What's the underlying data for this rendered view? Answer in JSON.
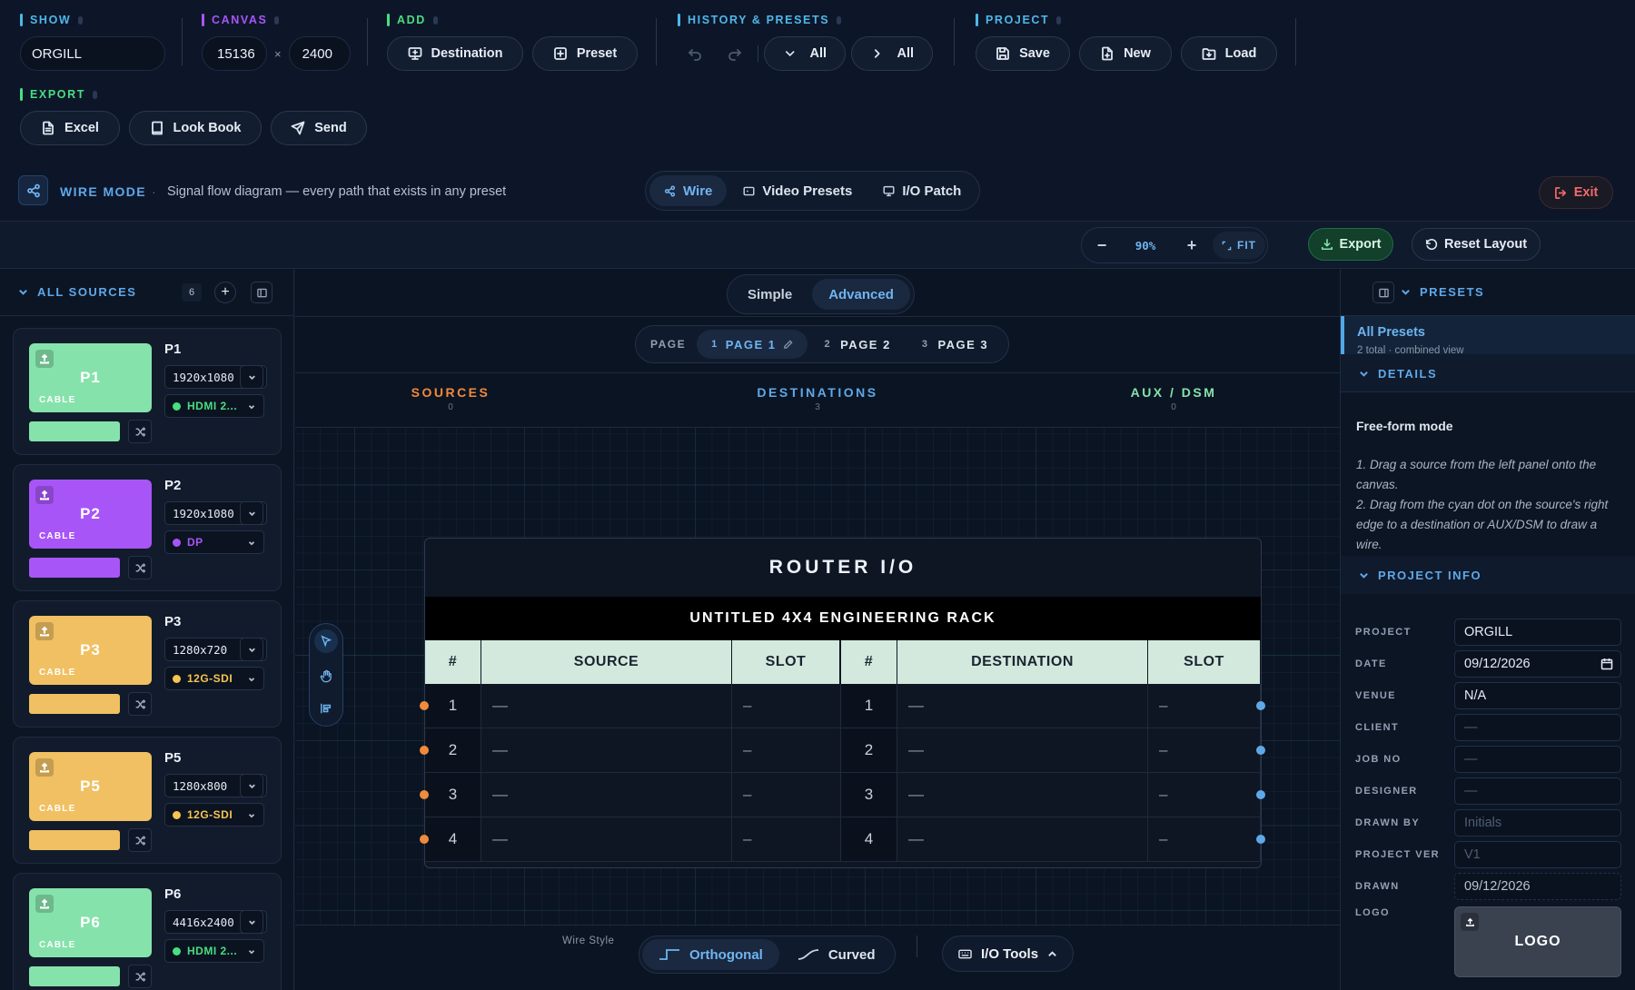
{
  "groups": {
    "show": {
      "label": "SHOW",
      "value": "ORGILL",
      "color": "#4fb8e8"
    },
    "canvas": {
      "label": "CANVAS",
      "width": "15136",
      "times": "×",
      "height": "2400",
      "color": "#a855f7"
    },
    "add": {
      "label": "ADD",
      "destination": "Destination",
      "preset": "Preset",
      "color": "#4ade80"
    },
    "history": {
      "label": "HISTORY & PRESETS",
      "collapse_all": "All",
      "expand_all": "All",
      "color": "#4fb8e8"
    },
    "project": {
      "label": "PROJECT",
      "save": "Save",
      "new": "New",
      "load": "Load",
      "color": "#4fb8e8"
    },
    "export": {
      "label": "EXPORT",
      "excel": "Excel",
      "lookbook": "Look Book",
      "send": "Send",
      "color": "#4ade80"
    }
  },
  "mode": {
    "title": "WIRE MODE",
    "sep": "·",
    "description": "Signal flow diagram — every path that exists in any preset",
    "tabs": [
      "Wire",
      "Video Presets",
      "I/O Patch"
    ],
    "exit": "Exit"
  },
  "zoom": {
    "minus": "−",
    "level": "90%",
    "plus": "+",
    "fit": "FIT",
    "export": "Export",
    "reset": "Reset Layout"
  },
  "sources_panel": {
    "title": "ALL SOURCES",
    "count": "6",
    "add": "+",
    "cards": [
      {
        "name": "P1",
        "label": "P1",
        "type": "CABLE",
        "res": "1920x1080",
        "signal": "HDMI 2...",
        "color": "#86e2ab",
        "sigcolor": "#4ade80",
        "textcolor": "#ffffff"
      },
      {
        "name": "P2",
        "label": "P2",
        "type": "CABLE",
        "res": "1920x1080",
        "signal": "DP",
        "color": "#a855f7",
        "sigcolor": "#a855f7",
        "textcolor": "#ffffff"
      },
      {
        "name": "P3",
        "label": "P3",
        "type": "CABLE",
        "res": "1280x720",
        "signal": "12G-SDI",
        "color": "#f0c062",
        "sigcolor": "#f5c451",
        "textcolor": "#ffffff"
      },
      {
        "name": "P5",
        "label": "P5",
        "type": "CABLE",
        "res": "1280x800",
        "signal": "12G-SDI",
        "color": "#f0c062",
        "sigcolor": "#f5c451",
        "textcolor": "#ffffff"
      },
      {
        "name": "P6",
        "label": "P6",
        "type": "CABLE",
        "res": "4416x2400",
        "signal": "HDMI 2...",
        "color": "#86e2ab",
        "sigcolor": "#4ade80",
        "textcolor": "#ffffff"
      }
    ]
  },
  "canvas_area": {
    "modes": [
      "Simple",
      "Advanced"
    ],
    "page_label": "PAGE",
    "pages": [
      {
        "num": "1",
        "label": "PAGE 1"
      },
      {
        "num": "2",
        "label": "PAGE 2"
      },
      {
        "num": "3",
        "label": "PAGE 3"
      }
    ],
    "columns": [
      {
        "title": "SOURCES",
        "count": "0",
        "color": "#f08a3c"
      },
      {
        "title": "DESTINATIONS",
        "count": "3",
        "color": "#5fa8e8"
      },
      {
        "title": "AUX / DSM",
        "count": "0",
        "color": "#86e2ab"
      }
    ],
    "router": {
      "title": "ROUTER I/O",
      "subtitle": "UNTITLED 4X4 ENGINEERING RACK",
      "headers": [
        "#",
        "SOURCE",
        "SLOT",
        "#",
        "DESTINATION",
        "SLOT"
      ],
      "rows": [
        [
          "1",
          "—",
          "–",
          "1",
          "—",
          "–"
        ],
        [
          "2",
          "—",
          "–",
          "2",
          "—",
          "–"
        ],
        [
          "3",
          "—",
          "–",
          "3",
          "—",
          "–"
        ],
        [
          "4",
          "—",
          "–",
          "4",
          "—",
          "–"
        ]
      ]
    },
    "wire_style_label": "Wire Style",
    "wire_styles": [
      "Orthogonal",
      "Curved"
    ],
    "io_tools": "I/O Tools"
  },
  "right_panel": {
    "presets_title": "PRESETS",
    "all_presets": "All Presets",
    "all_presets_sub": "2 total · combined view",
    "details_title": "DETAILS",
    "freeform_title": "Free-form mode",
    "instructions": [
      "1. Drag a source from the left panel onto the canvas.",
      "2. Drag from the cyan dot on the source's right edge to a destination or AUX/DSM to draw a wire."
    ],
    "project_info_title": "PROJECT INFO",
    "fields": [
      {
        "label": "PROJECT",
        "value": "ORGILL",
        "style": "value"
      },
      {
        "label": "DATE",
        "value": "09/12/2026",
        "style": "value"
      },
      {
        "label": "VENUE",
        "value": "N/A",
        "style": "value"
      },
      {
        "label": "CLIENT",
        "value": "—",
        "style": "ph"
      },
      {
        "label": "JOB NO",
        "value": "—",
        "style": "ph"
      },
      {
        "label": "DESIGNER",
        "value": "—",
        "style": "ph"
      },
      {
        "label": "DRAWN BY",
        "value": "Initials",
        "style": "ph"
      },
      {
        "label": "PROJECT VER",
        "value": "V1",
        "style": "ph"
      },
      {
        "label": "DRAWN",
        "value": "09/12/2026",
        "style": "dash"
      }
    ],
    "logo_label": "LOGO",
    "logo_text": "LOGO"
  }
}
